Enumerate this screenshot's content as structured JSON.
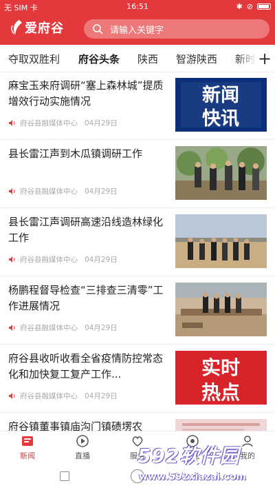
{
  "colors": {
    "brand": "#e4393c",
    "text": "#222222",
    "meta": "#aaaaaa"
  },
  "status_bar": {
    "carrier": "无 SIM 卡",
    "time": "16:51"
  },
  "header": {
    "app_name": "爱府谷",
    "search_placeholder": "请输入关键字"
  },
  "tabs": [
    {
      "label": "夺取双胜利",
      "active": false
    },
    {
      "label": "府谷头条",
      "active": true
    },
    {
      "label": "陕西",
      "active": false
    },
    {
      "label": "智游陕西",
      "active": false
    },
    {
      "label": "新时",
      "active": false
    }
  ],
  "news": [
    {
      "title": "麻宝玉来府调研“塞上森林城”提质增效行动实施情况",
      "source": "府谷县融媒体中心",
      "date": "04月29日",
      "thumb": "新闻快讯"
    },
    {
      "title": "县长雷江声到木瓜镇调研工作",
      "source": "府谷县融媒体中心",
      "date": "04月29日",
      "thumb": "photo-orchard"
    },
    {
      "title": "县长雷江声调研高速沿线造林绿化工作",
      "source": "府谷县融媒体中心",
      "date": "04月29日",
      "thumb": "photo-field"
    },
    {
      "title": "杨鹏程督导检查“三排查三清零”工作进展情况",
      "source": "府谷县融媒体中心",
      "date": "04月29日",
      "thumb": "photo-construction"
    },
    {
      "title": "府谷县收听收看全省疫情防控常态化和加快复工复产工作...",
      "source": "府谷县融媒体中心",
      "date": "04月29日",
      "thumb": "实时热点"
    },
    {
      "title": "府谷镇董事镇庙沟门镇碛塄农",
      "source": "",
      "date": "",
      "thumb": "banner"
    }
  ],
  "thumb_text": {
    "xinwen": "新闻",
    "kuaixun": "快讯",
    "shi": "实时",
    "redian": "热点"
  },
  "bottom_nav": [
    {
      "label": "新闻",
      "active": true
    },
    {
      "label": "直播",
      "active": false
    },
    {
      "label": "服务",
      "active": false
    },
    {
      "label": "社区",
      "active": false
    },
    {
      "label": "我的",
      "active": false
    }
  ],
  "watermark": {
    "brand": "592软件园",
    "url": "www.592xiazai.com"
  }
}
